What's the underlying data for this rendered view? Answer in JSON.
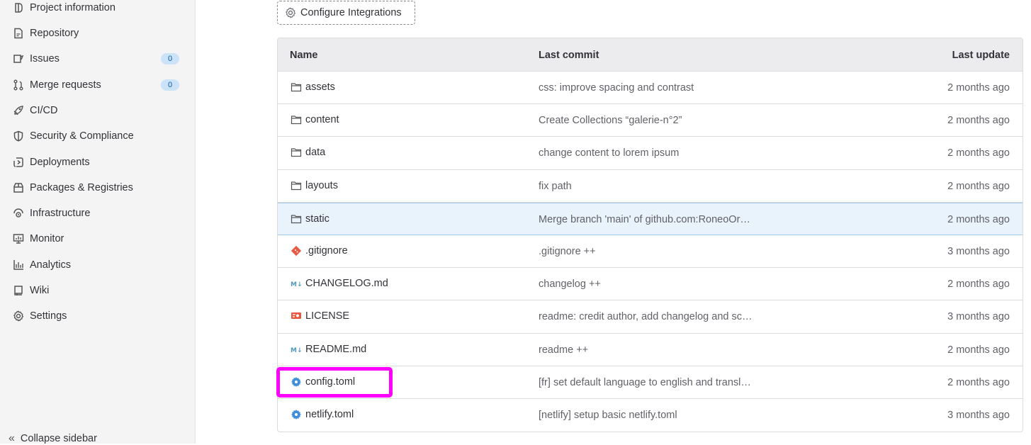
{
  "sidebar": {
    "items": [
      {
        "label": "Project information",
        "icon": "project-icon"
      },
      {
        "label": "Repository",
        "icon": "document-icon"
      },
      {
        "label": "Issues",
        "icon": "issues-icon",
        "badge": "0"
      },
      {
        "label": "Merge requests",
        "icon": "merge-request-icon",
        "badge": "0"
      },
      {
        "label": "CI/CD",
        "icon": "rocket-icon"
      },
      {
        "label": "Security & Compliance",
        "icon": "shield-icon"
      },
      {
        "label": "Deployments",
        "icon": "deployments-icon"
      },
      {
        "label": "Packages & Registries",
        "icon": "package-icon"
      },
      {
        "label": "Infrastructure",
        "icon": "cloud-gear-icon"
      },
      {
        "label": "Monitor",
        "icon": "monitor-icon"
      },
      {
        "label": "Analytics",
        "icon": "chart-icon"
      },
      {
        "label": "Wiki",
        "icon": "book-icon"
      },
      {
        "label": "Settings",
        "icon": "gear-icon"
      }
    ],
    "collapse_label": "Collapse sidebar"
  },
  "toolbar": {
    "configure_label": "Configure Integrations"
  },
  "table": {
    "headers": {
      "name": "Name",
      "commit": "Last commit",
      "update": "Last update"
    },
    "rows": [
      {
        "name": "assets",
        "type": "folder",
        "commit": "css: improve spacing and contrast",
        "update": "2 months ago"
      },
      {
        "name": "content",
        "type": "folder",
        "commit": "Create Collections “galerie-n°2”",
        "update": "2 months ago"
      },
      {
        "name": "data",
        "type": "folder",
        "commit": "change content to lorem ipsum",
        "update": "2 months ago"
      },
      {
        "name": "layouts",
        "type": "folder",
        "commit": "fix path",
        "update": "2 months ago"
      },
      {
        "name": "static",
        "type": "folder",
        "commit": "Merge branch 'main' of github.com:RoneoOr…",
        "update": "2 months ago"
      },
      {
        "name": ".gitignore",
        "type": "git",
        "commit": ".gitignore ++",
        "update": "3 months ago"
      },
      {
        "name": "CHANGELOG.md",
        "type": "markdown",
        "commit": "changelog ++",
        "update": "2 months ago"
      },
      {
        "name": "LICENSE",
        "type": "license",
        "commit": "readme: credit author, add changelog and sc…",
        "update": "3 months ago"
      },
      {
        "name": "README.md",
        "type": "markdown",
        "commit": "readme ++",
        "update": "2 months ago"
      },
      {
        "name": "config.toml",
        "type": "config",
        "commit": "[fr] set default language to english and transl…",
        "update": "2 months ago"
      },
      {
        "name": "netlify.toml",
        "type": "config",
        "commit": "[netlify] setup basic netlify.toml",
        "update": "3 months ago"
      }
    ]
  },
  "colors": {
    "highlight": "#ff00ff",
    "badge_bg": "#cbe2f9",
    "row_hover": "#e9f3fc"
  }
}
